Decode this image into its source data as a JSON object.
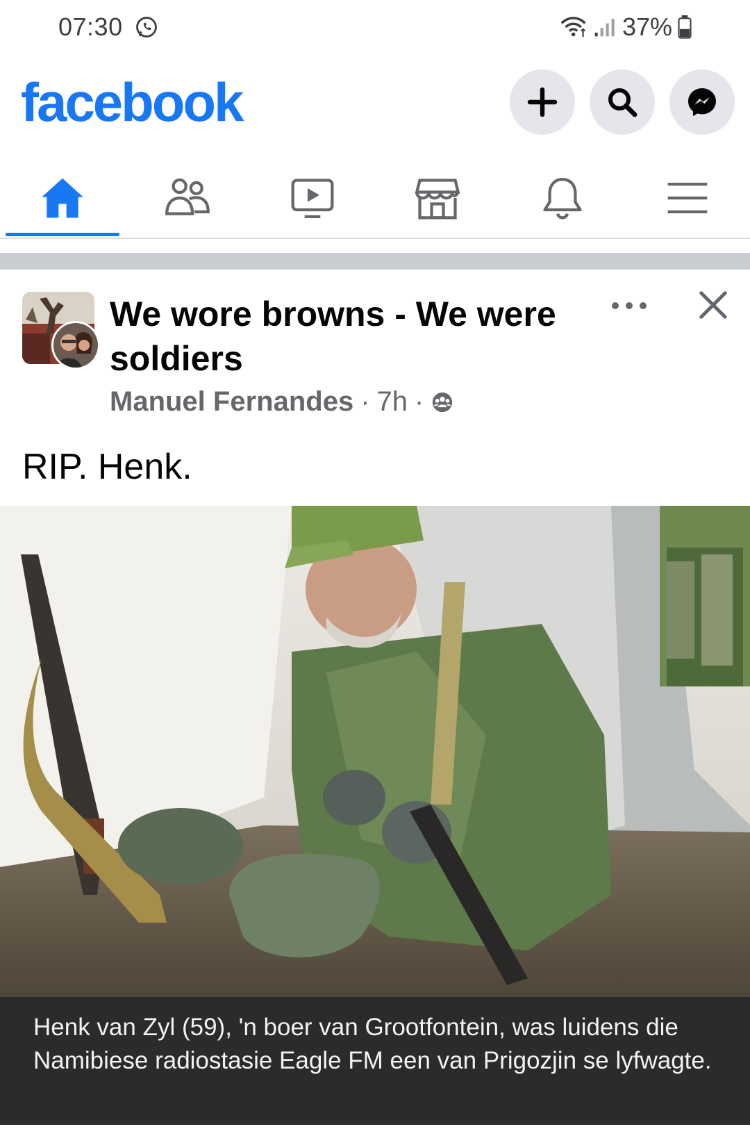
{
  "status_bar": {
    "time": "07:30",
    "battery": "37%",
    "icons": [
      "whatsapp-icon",
      "wifi-icon",
      "signal-icon",
      "battery-icon"
    ]
  },
  "header": {
    "logo": "facebook",
    "buttons": [
      "plus-icon",
      "search-icon",
      "messenger-icon"
    ]
  },
  "tabs": [
    {
      "name": "home",
      "icon": "home-icon",
      "active": true
    },
    {
      "name": "friends",
      "icon": "friends-icon",
      "active": false
    },
    {
      "name": "watch",
      "icon": "video-icon",
      "active": false
    },
    {
      "name": "marketplace",
      "icon": "store-icon",
      "active": false
    },
    {
      "name": "notifications",
      "icon": "bell-icon",
      "active": false
    },
    {
      "name": "menu",
      "icon": "hamburger-icon",
      "active": false
    }
  ],
  "post": {
    "group_name": "We wore browns - We were soldiers",
    "author": "Manuel Fernandes",
    "time": "7h",
    "meta_separator": "·",
    "audience_icon": "group-icon",
    "text": "RIP. Henk.",
    "image_caption": "Henk van Zyl (59), 'n boer van Grootfontein, was luidens die Namibiese radiostasie Eagle FM een van Prigozjin se lyfwagte."
  },
  "colors": {
    "brand": "#1877f2",
    "secondary_text": "#65676b",
    "button_bg": "#e4e6eb",
    "caption_bg": "#2b2b2b"
  }
}
